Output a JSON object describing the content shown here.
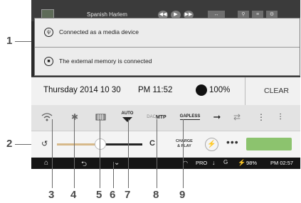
{
  "callouts": {
    "c1": "1",
    "c2": "2",
    "c3": "3",
    "c4": "4",
    "c5": "5",
    "c6": "6",
    "c7": "7",
    "c8": "8",
    "c9": "9"
  },
  "topbar": {
    "song_title": "Spanish Harlem"
  },
  "notifications": [
    {
      "icon": "usb-icon",
      "text": "Connected as a media device"
    },
    {
      "icon": "memory-card-icon",
      "text": "The external memory is connected"
    }
  ],
  "status": {
    "date": "Thursday 2014 10 30",
    "time": "PM 11:52",
    "battery": "100%",
    "clear_label": "CLEAR"
  },
  "quick_settings": {
    "auto_label": "AUTO",
    "dac_label": "DAC",
    "mtp_label": "MTP",
    "gapless_label": "GAPLESS"
  },
  "slider_row": {
    "brightness_level": 0.5,
    "c_label": "C",
    "charge_label_1": "CHARGE",
    "charge_label_2": "& PLAY",
    "more_label": "•••"
  },
  "navbar": {
    "pro_label": "PRO",
    "battery_pct": "98%",
    "clock": "PM 02:57"
  },
  "colors": {
    "accent_green": "#8cc36e",
    "slider_bright": "#d7b98a"
  }
}
